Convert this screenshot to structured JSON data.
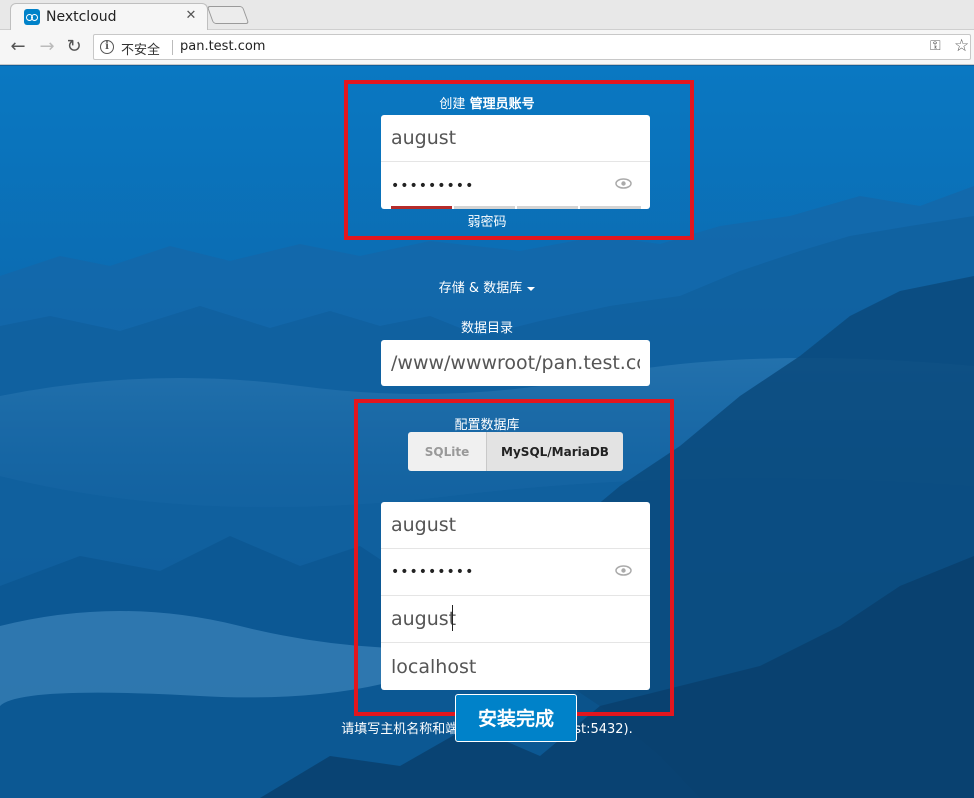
{
  "browser": {
    "tab_title": "Nextcloud",
    "insecure_label": "不安全",
    "url": "pan.test.com"
  },
  "admin": {
    "heading_prefix": "创建 ",
    "heading_bold": "管理员账号",
    "username": "august",
    "password_mask": "•••••••••",
    "strength_label": "弱密码",
    "strength_level": 0.25
  },
  "storage": {
    "toggle_label": "存储 & 数据库",
    "data_dir_label": "数据目录",
    "data_dir_value": "/www/wwwroot/pan.test.com"
  },
  "database": {
    "heading": "配置数据库",
    "options": [
      "SQLite",
      "MySQL/MariaDB"
    ],
    "selected": "MySQL/MariaDB",
    "user": "august",
    "password_mask": "•••••••••",
    "name": "august",
    "host": "localhost",
    "host_hint": "请填写主机名称和端口号 (示例, localhost:5432)."
  },
  "finish_label": "安装完成",
  "colors": {
    "brand_blue": "#0082c9",
    "highlight_red": "#e3161e",
    "weak_red": "#b52c2c"
  }
}
